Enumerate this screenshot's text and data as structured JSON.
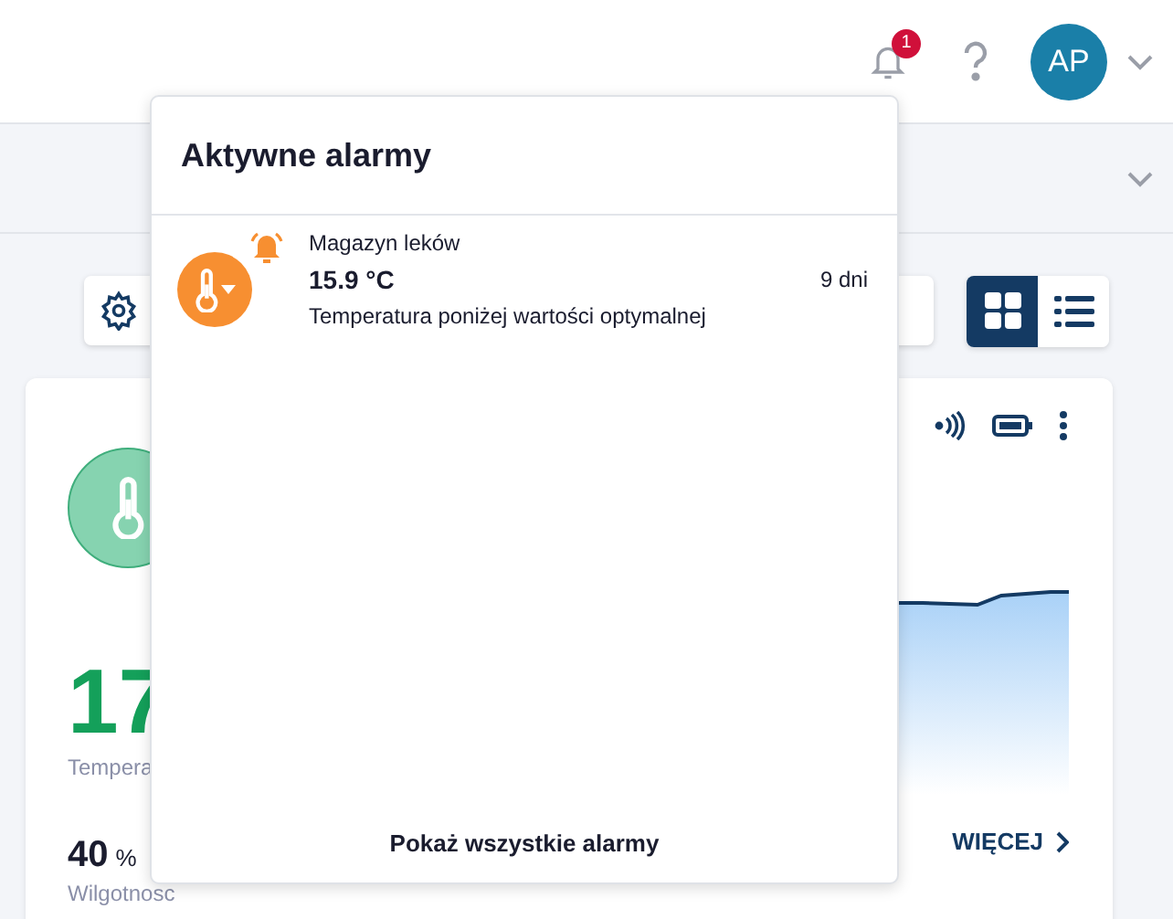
{
  "header": {
    "notifications": {
      "badge": "1"
    },
    "user": {
      "initials": "AP"
    }
  },
  "toolbar": {
    "view_modes": [
      {
        "kind": "grid",
        "selected": true
      },
      {
        "kind": "list",
        "selected": false
      }
    ]
  },
  "card": {
    "reading": "17",
    "reading_label": "Tempera",
    "humidity": "40",
    "humidity_unit": "%",
    "humidity_label": "Wilgotnosc",
    "more_link": "WIĘCEJ"
  },
  "alarms_popover": {
    "title": "Aktywne alarmy",
    "alarms": [
      {
        "location": "Magazyn leków",
        "value": "15.9 °C",
        "age": "9 dni",
        "message": "Temperatura poniżej wartości optymalnej"
      }
    ],
    "footer_link": "Pokaż wszystkie alarmy"
  }
}
